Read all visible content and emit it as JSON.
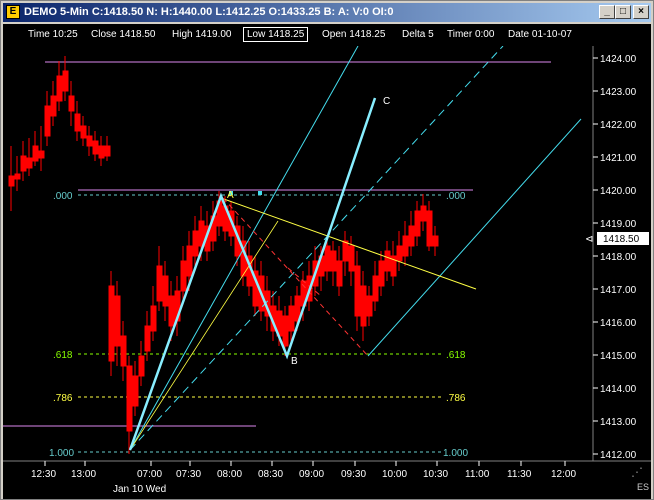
{
  "window": {
    "title": "DEMO 5-Min C:1418.50 N: H:1440.00 L:1412.25 O:1433.25 B: A: V:0 OI:0",
    "min_glyph": "_",
    "max_glyph": "□",
    "close_glyph": "×"
  },
  "infobar": {
    "time": "Time 10:25",
    "close": "Close 1418.50",
    "high": "High 1419.00",
    "low": "Low 1418.25",
    "open": "Open 1418.25",
    "delta": "Delta 5",
    "timer": "Timer 0:00",
    "date": "Date 01-10-07"
  },
  "chart": {
    "price_labels": [
      "1424.00",
      "1423.00",
      "1422.00",
      "1421.00",
      "1420.00",
      "1419.00",
      "1418.00",
      "1417.00",
      "1416.00",
      "1415.00",
      "1414.00",
      "1413.00",
      "1412.00"
    ],
    "current_price": "1418.50",
    "time_labels": [
      "12:30",
      "13:00",
      "07:00",
      "07:30",
      "08:00",
      "08:30",
      "09:00",
      "09:30",
      "10:00",
      "10:30",
      "11:00",
      "11:30",
      "12:00"
    ],
    "date_label": "Jan 10 Wed",
    "fib_levels": [
      ".000",
      ".618",
      ".786",
      "1.000"
    ],
    "points": {
      "a": "A",
      "b": "B",
      "c": "C"
    },
    "footer": "ES",
    "colors": {
      "up": "#00ff00",
      "down": "#ff0000",
      "fib_cyan": "#66cccc",
      "fib_green": "#88ff00",
      "fib_yellow": "#ffff44",
      "channel": "#44ddee",
      "magenta": "#dd88ee",
      "yellow_line": "#ffff44",
      "dashed_red": "#ff3333"
    }
  }
}
